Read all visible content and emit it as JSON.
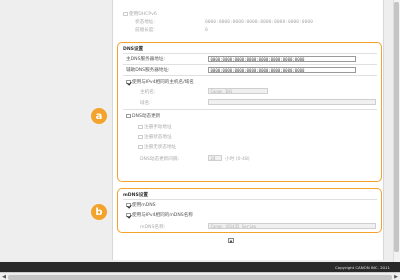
{
  "top": {
    "ipv6_dhcp_label": "使用DHCPv6",
    "stateful_address_label": "状态地址:",
    "stateful_address_value": "0000:0000:0000:0000:0000:0000:0000:0000",
    "prefix_length_label": "前缀长度:",
    "prefix_length_value": "0"
  },
  "dns": {
    "title": "DNS设置",
    "primary_label": "主DNS服务器地址:",
    "primary_value": "0000:0000:0000:0000:0000:0000:0000:0000",
    "secondary_label": "辅助DNS服务器地址:",
    "secondary_value": "0000:0000:0000:0000:0000:0000:0000:0000",
    "same_host_label": "使用与IPv4相同的主机名/域名",
    "same_host_checked": true,
    "host_name_label": "主机名:",
    "host_name_value": "Canon 1H1",
    "domain_name_label": "域名:",
    "domain_name_value": "",
    "dynamic_update_label": "DNS动态更新",
    "dynamic_update_checked": false,
    "register_manual_label": "注册手动地址",
    "register_stateful_label": "注册状态地址",
    "register_stateless_label": "注册无状态地址",
    "update_interval_label": "DNS动态更新间隔:",
    "update_interval_value": "24",
    "update_interval_unit": "小时 (0-48)"
  },
  "mdns": {
    "title": "mDNS设置",
    "use_mdns_label": "使用mDNS",
    "use_mdns_checked": true,
    "same_name_label": "使用与IPv4相同的mDNS名称",
    "same_name_checked": true,
    "mdns_name_label": "mDNS名称:",
    "mdns_name_value": "Canon iR1435 Series"
  },
  "badges": {
    "a": "a",
    "b": "b"
  },
  "footer": {
    "copyright": "Copyright CANON INC. 2011"
  },
  "colors": {
    "accent": "#f3a32b",
    "footer_bg": "#2a2a2a"
  }
}
